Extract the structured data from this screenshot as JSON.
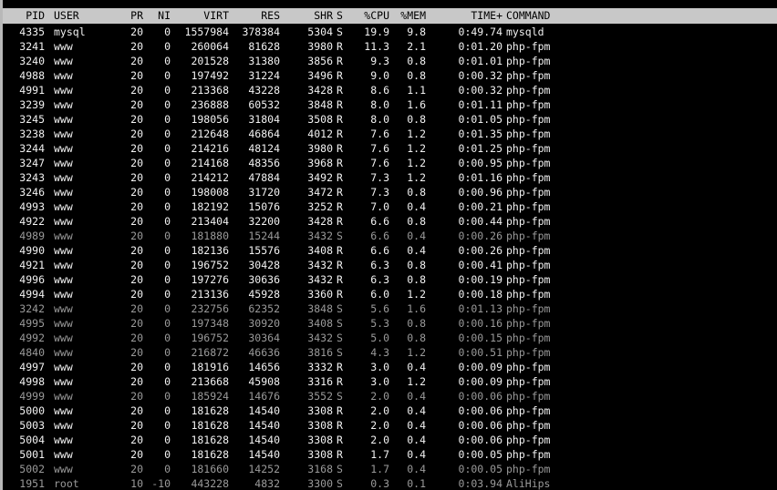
{
  "colors": {
    "background": "#000000",
    "header_background": "#c8c8c8",
    "header_text": "#000000",
    "running_text": "#f2f2f2",
    "sleeping_text": "#9a9a9a"
  },
  "header": {
    "pid": "PID",
    "user": "USER",
    "pr": "PR",
    "ni": "NI",
    "virt": "VIRT",
    "res": "RES",
    "shr": "SHR",
    "s": "S",
    "cpu": "%CPU",
    "mem": "%MEM",
    "time": "TIME+",
    "command": "COMMAND"
  },
  "processes": [
    {
      "pid": "4335",
      "user": "mysql",
      "pr": "20",
      "ni": "0",
      "virt": "1557984",
      "res": "378384",
      "shr": "5304",
      "s": "S",
      "cpu": "19.9",
      "mem": "9.8",
      "time": "0:49.74",
      "command": "mysqld"
    },
    {
      "pid": "3241",
      "user": "www",
      "pr": "20",
      "ni": "0",
      "virt": "260064",
      "res": "81628",
      "shr": "3980",
      "s": "R",
      "cpu": "11.3",
      "mem": "2.1",
      "time": "0:01.20",
      "command": "php-fpm"
    },
    {
      "pid": "3240",
      "user": "www",
      "pr": "20",
      "ni": "0",
      "virt": "201528",
      "res": "31380",
      "shr": "3856",
      "s": "R",
      "cpu": "9.3",
      "mem": "0.8",
      "time": "0:01.01",
      "command": "php-fpm"
    },
    {
      "pid": "4988",
      "user": "www",
      "pr": "20",
      "ni": "0",
      "virt": "197492",
      "res": "31224",
      "shr": "3496",
      "s": "R",
      "cpu": "9.0",
      "mem": "0.8",
      "time": "0:00.32",
      "command": "php-fpm"
    },
    {
      "pid": "4991",
      "user": "www",
      "pr": "20",
      "ni": "0",
      "virt": "213368",
      "res": "43228",
      "shr": "3428",
      "s": "R",
      "cpu": "8.6",
      "mem": "1.1",
      "time": "0:00.32",
      "command": "php-fpm"
    },
    {
      "pid": "3239",
      "user": "www",
      "pr": "20",
      "ni": "0",
      "virt": "236888",
      "res": "60532",
      "shr": "3848",
      "s": "R",
      "cpu": "8.0",
      "mem": "1.6",
      "time": "0:01.11",
      "command": "php-fpm"
    },
    {
      "pid": "3245",
      "user": "www",
      "pr": "20",
      "ni": "0",
      "virt": "198056",
      "res": "31804",
      "shr": "3508",
      "s": "R",
      "cpu": "8.0",
      "mem": "0.8",
      "time": "0:01.05",
      "command": "php-fpm"
    },
    {
      "pid": "3238",
      "user": "www",
      "pr": "20",
      "ni": "0",
      "virt": "212648",
      "res": "46864",
      "shr": "4012",
      "s": "R",
      "cpu": "7.6",
      "mem": "1.2",
      "time": "0:01.35",
      "command": "php-fpm"
    },
    {
      "pid": "3244",
      "user": "www",
      "pr": "20",
      "ni": "0",
      "virt": "214216",
      "res": "48124",
      "shr": "3980",
      "s": "R",
      "cpu": "7.6",
      "mem": "1.2",
      "time": "0:01.25",
      "command": "php-fpm"
    },
    {
      "pid": "3247",
      "user": "www",
      "pr": "20",
      "ni": "0",
      "virt": "214168",
      "res": "48356",
      "shr": "3968",
      "s": "R",
      "cpu": "7.6",
      "mem": "1.2",
      "time": "0:00.95",
      "command": "php-fpm"
    },
    {
      "pid": "3243",
      "user": "www",
      "pr": "20",
      "ni": "0",
      "virt": "214212",
      "res": "47884",
      "shr": "3492",
      "s": "R",
      "cpu": "7.3",
      "mem": "1.2",
      "time": "0:01.16",
      "command": "php-fpm"
    },
    {
      "pid": "3246",
      "user": "www",
      "pr": "20",
      "ni": "0",
      "virt": "198008",
      "res": "31720",
      "shr": "3472",
      "s": "R",
      "cpu": "7.3",
      "mem": "0.8",
      "time": "0:00.96",
      "command": "php-fpm"
    },
    {
      "pid": "4993",
      "user": "www",
      "pr": "20",
      "ni": "0",
      "virt": "182192",
      "res": "15076",
      "shr": "3252",
      "s": "R",
      "cpu": "7.0",
      "mem": "0.4",
      "time": "0:00.21",
      "command": "php-fpm"
    },
    {
      "pid": "4922",
      "user": "www",
      "pr": "20",
      "ni": "0",
      "virt": "213404",
      "res": "32200",
      "shr": "3428",
      "s": "R",
      "cpu": "6.6",
      "mem": "0.8",
      "time": "0:00.44",
      "command": "php-fpm"
    },
    {
      "pid": "4989",
      "user": "www",
      "pr": "20",
      "ni": "0",
      "virt": "181880",
      "res": "15244",
      "shr": "3432",
      "s": "S",
      "cpu": "6.6",
      "mem": "0.4",
      "time": "0:00.26",
      "command": "php-fpm"
    },
    {
      "pid": "4990",
      "user": "www",
      "pr": "20",
      "ni": "0",
      "virt": "182136",
      "res": "15576",
      "shr": "3408",
      "s": "R",
      "cpu": "6.6",
      "mem": "0.4",
      "time": "0:00.26",
      "command": "php-fpm"
    },
    {
      "pid": "4921",
      "user": "www",
      "pr": "20",
      "ni": "0",
      "virt": "196752",
      "res": "30428",
      "shr": "3432",
      "s": "R",
      "cpu": "6.3",
      "mem": "0.8",
      "time": "0:00.41",
      "command": "php-fpm"
    },
    {
      "pid": "4996",
      "user": "www",
      "pr": "20",
      "ni": "0",
      "virt": "197276",
      "res": "30636",
      "shr": "3432",
      "s": "R",
      "cpu": "6.3",
      "mem": "0.8",
      "time": "0:00.19",
      "command": "php-fpm"
    },
    {
      "pid": "4994",
      "user": "www",
      "pr": "20",
      "ni": "0",
      "virt": "213136",
      "res": "45928",
      "shr": "3360",
      "s": "R",
      "cpu": "6.0",
      "mem": "1.2",
      "time": "0:00.18",
      "command": "php-fpm"
    },
    {
      "pid": "3242",
      "user": "www",
      "pr": "20",
      "ni": "0",
      "virt": "232756",
      "res": "62352",
      "shr": "3848",
      "s": "S",
      "cpu": "5.6",
      "mem": "1.6",
      "time": "0:01.13",
      "command": "php-fpm"
    },
    {
      "pid": "4995",
      "user": "www",
      "pr": "20",
      "ni": "0",
      "virt": "197348",
      "res": "30920",
      "shr": "3408",
      "s": "S",
      "cpu": "5.3",
      "mem": "0.8",
      "time": "0:00.16",
      "command": "php-fpm"
    },
    {
      "pid": "4992",
      "user": "www",
      "pr": "20",
      "ni": "0",
      "virt": "196752",
      "res": "30364",
      "shr": "3432",
      "s": "S",
      "cpu": "5.0",
      "mem": "0.8",
      "time": "0:00.15",
      "command": "php-fpm"
    },
    {
      "pid": "4840",
      "user": "www",
      "pr": "20",
      "ni": "0",
      "virt": "216872",
      "res": "46636",
      "shr": "3816",
      "s": "S",
      "cpu": "4.3",
      "mem": "1.2",
      "time": "0:00.51",
      "command": "php-fpm"
    },
    {
      "pid": "4997",
      "user": "www",
      "pr": "20",
      "ni": "0",
      "virt": "181916",
      "res": "14656",
      "shr": "3332",
      "s": "R",
      "cpu": "3.0",
      "mem": "0.4",
      "time": "0:00.09",
      "command": "php-fpm"
    },
    {
      "pid": "4998",
      "user": "www",
      "pr": "20",
      "ni": "0",
      "virt": "213668",
      "res": "45908",
      "shr": "3316",
      "s": "R",
      "cpu": "3.0",
      "mem": "1.2",
      "time": "0:00.09",
      "command": "php-fpm"
    },
    {
      "pid": "4999",
      "user": "www",
      "pr": "20",
      "ni": "0",
      "virt": "185924",
      "res": "14676",
      "shr": "3552",
      "s": "S",
      "cpu": "2.0",
      "mem": "0.4",
      "time": "0:00.06",
      "command": "php-fpm"
    },
    {
      "pid": "5000",
      "user": "www",
      "pr": "20",
      "ni": "0",
      "virt": "181628",
      "res": "14540",
      "shr": "3308",
      "s": "R",
      "cpu": "2.0",
      "mem": "0.4",
      "time": "0:00.06",
      "command": "php-fpm"
    },
    {
      "pid": "5003",
      "user": "www",
      "pr": "20",
      "ni": "0",
      "virt": "181628",
      "res": "14540",
      "shr": "3308",
      "s": "R",
      "cpu": "2.0",
      "mem": "0.4",
      "time": "0:00.06",
      "command": "php-fpm"
    },
    {
      "pid": "5004",
      "user": "www",
      "pr": "20",
      "ni": "0",
      "virt": "181628",
      "res": "14540",
      "shr": "3308",
      "s": "R",
      "cpu": "2.0",
      "mem": "0.4",
      "time": "0:00.06",
      "command": "php-fpm"
    },
    {
      "pid": "5001",
      "user": "www",
      "pr": "20",
      "ni": "0",
      "virt": "181628",
      "res": "14540",
      "shr": "3308",
      "s": "R",
      "cpu": "1.7",
      "mem": "0.4",
      "time": "0:00.05",
      "command": "php-fpm"
    },
    {
      "pid": "5002",
      "user": "www",
      "pr": "20",
      "ni": "0",
      "virt": "181660",
      "res": "14252",
      "shr": "3168",
      "s": "S",
      "cpu": "1.7",
      "mem": "0.4",
      "time": "0:00.05",
      "command": "php-fpm"
    },
    {
      "pid": "1951",
      "user": "root",
      "pr": "10",
      "ni": "-10",
      "virt": "443228",
      "res": "4832",
      "shr": "3300",
      "s": "S",
      "cpu": "0.3",
      "mem": "0.1",
      "time": "0:03.94",
      "command": "AliHips"
    }
  ]
}
